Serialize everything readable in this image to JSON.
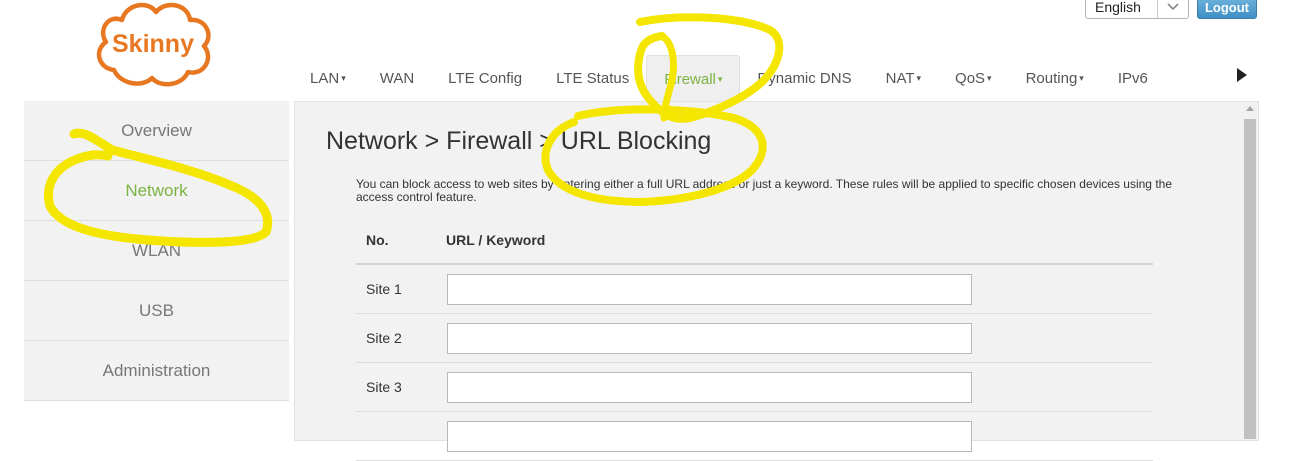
{
  "logo": {
    "text": "Skinny",
    "color": "#e87722"
  },
  "header": {
    "language": "English",
    "logout_label": "Logout"
  },
  "topnav": [
    {
      "label": "LAN",
      "caret": "▾"
    },
    {
      "label": "WAN",
      "caret": ""
    },
    {
      "label": "LTE Config",
      "caret": ""
    },
    {
      "label": "LTE Status",
      "caret": ""
    },
    {
      "label": "Firewall",
      "caret": "▾",
      "active": true
    },
    {
      "label": "Dynamic DNS",
      "caret": ""
    },
    {
      "label": "NAT",
      "caret": "▾"
    },
    {
      "label": "QoS",
      "caret": "▾"
    },
    {
      "label": "Routing",
      "caret": "▾"
    },
    {
      "label": "IPv6",
      "caret": ""
    }
  ],
  "sidebar": {
    "items": [
      {
        "label": "Overview"
      },
      {
        "label": "Network",
        "active": true
      },
      {
        "label": "WLAN"
      },
      {
        "label": "USB"
      },
      {
        "label": "Administration"
      }
    ]
  },
  "main": {
    "title": "Network > Firewall > URL Blocking",
    "description": "You can block access to web sites by entering either a full URL address or just a keyword. These rules will be applied to specific chosen devices using the access control feature.",
    "table": {
      "headers": {
        "no": "No.",
        "url": "URL / Keyword"
      },
      "rows": [
        {
          "label": "Site 1",
          "value": ""
        },
        {
          "label": "Site 2",
          "value": ""
        },
        {
          "label": "Site 3",
          "value": ""
        },
        {
          "label": "",
          "value": ""
        }
      ]
    }
  },
  "colors": {
    "accent_green": "#7cb342",
    "annotation_yellow": "#f5e600",
    "logout_blue": "#4a9ad0"
  }
}
